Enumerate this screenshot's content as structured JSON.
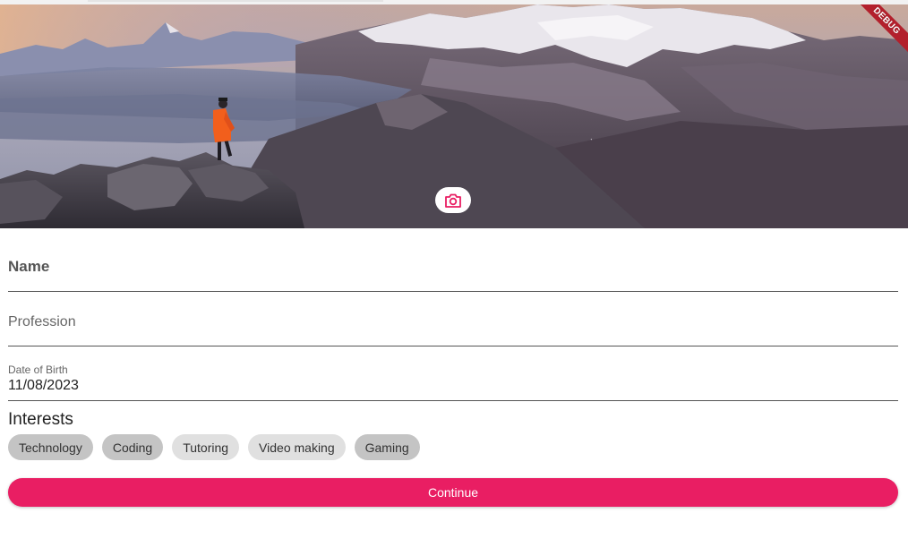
{
  "cover": {
    "image": "mountain-landscape-photo",
    "camera_icon": "camera-icon",
    "debug_banner": "DEBUG"
  },
  "form": {
    "name": {
      "label": "Name",
      "value": ""
    },
    "profession": {
      "label": "Profession",
      "value": ""
    },
    "date_of_birth": {
      "label": "Date of Birth",
      "value": "11/08/2023"
    }
  },
  "interests": {
    "title": "Interests",
    "chips": [
      {
        "label": "Technology",
        "selected": true
      },
      {
        "label": "Coding",
        "selected": true
      },
      {
        "label": "Tutoring",
        "selected": false
      },
      {
        "label": "Video making",
        "selected": false
      },
      {
        "label": "Gaming",
        "selected": true
      }
    ]
  },
  "actions": {
    "continue_label": "Continue"
  },
  "colors": {
    "accent": "#e91e63",
    "chip_selected": "#c4c4c4",
    "chip_unselected": "#e0e0e0",
    "debug_banner": "#b3202c"
  }
}
